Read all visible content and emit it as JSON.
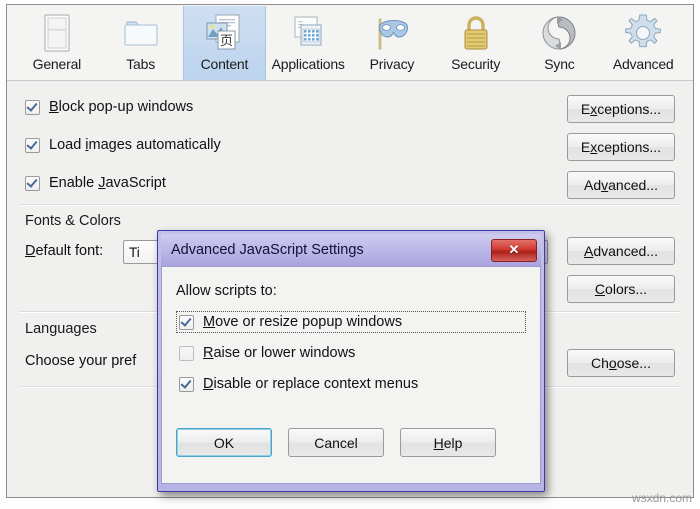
{
  "window": {
    "tabs": [
      {
        "label": "General",
        "icon": "page-icon",
        "selected": false
      },
      {
        "label": "Tabs",
        "icon": "folder-icon",
        "selected": false
      },
      {
        "label": "Content",
        "icon": "content-icon",
        "selected": true
      },
      {
        "label": "Applications",
        "icon": "applications-icon",
        "selected": false
      },
      {
        "label": "Privacy",
        "icon": "mask-icon",
        "selected": false
      },
      {
        "label": "Security",
        "icon": "padlock-icon",
        "selected": false
      },
      {
        "label": "Sync",
        "icon": "sync-icon",
        "selected": false
      },
      {
        "label": "Advanced",
        "icon": "gear-icon",
        "selected": false
      }
    ]
  },
  "content_panel": {
    "checkboxes": [
      {
        "label_pre": "",
        "accel": "B",
        "label_post": "lock pop-up windows",
        "checked": true
      },
      {
        "label_pre": "Load ",
        "accel": "i",
        "label_post": "mages automatically",
        "checked": true
      },
      {
        "label_pre": "Enable ",
        "accel": "J",
        "label_post": "avaScript",
        "checked": true
      }
    ],
    "side_buttons": [
      {
        "pre": "E",
        "accel": "x",
        "post": "ceptions...",
        "name": "exceptions-popups-button"
      },
      {
        "pre": "E",
        "accel": "x",
        "post": "ceptions...",
        "name": "exceptions-images-button"
      },
      {
        "pre": "Ad",
        "accel": "v",
        "post": "anced...",
        "name": "advanced-javascript-button"
      }
    ],
    "fonts_section": {
      "title": "Fonts & Colors",
      "default_font_label_pre": "",
      "default_font_accel": "D",
      "default_font_label_post": "efault font:",
      "default_font_value": "Ti",
      "advanced_button": {
        "pre": "",
        "accel": "A",
        "post": "dvanced..."
      },
      "colors_button": {
        "pre": "",
        "accel": "C",
        "post": "olors..."
      }
    },
    "languages_section": {
      "title": "Languages",
      "description": "Choose your pref",
      "choose_button": {
        "pre": "Ch",
        "accel": "o",
        "post": "ose..."
      }
    }
  },
  "dialog": {
    "title": "Advanced JavaScript Settings",
    "close_label": "✕",
    "allow_label": "Allow scripts to:",
    "checkboxes": [
      {
        "pre": "",
        "accel": "M",
        "post": "ove or resize popup windows",
        "checked": true,
        "focused": true
      },
      {
        "pre": "",
        "accel": "R",
        "post": "aise or lower windows",
        "checked": false,
        "focused": false
      },
      {
        "pre": "",
        "accel": "D",
        "post": "isable or replace context menus",
        "checked": true,
        "focused": false
      }
    ],
    "buttons": [
      {
        "pre": "OK",
        "accel": "",
        "post": "",
        "name": "ok-button",
        "default": true
      },
      {
        "pre": "Cancel",
        "accel": "",
        "post": "",
        "name": "cancel-button",
        "default": false
      },
      {
        "pre": "",
        "accel": "H",
        "post": "elp",
        "name": "help-button",
        "default": false
      }
    ]
  },
  "watermark": "wsxdn.com",
  "colors": {
    "selected_tab": "#bcd4ee",
    "dialog_frame": "#3b3bab",
    "close_button": "#cf3b33",
    "default_button_glow": "#4ba3c7"
  }
}
